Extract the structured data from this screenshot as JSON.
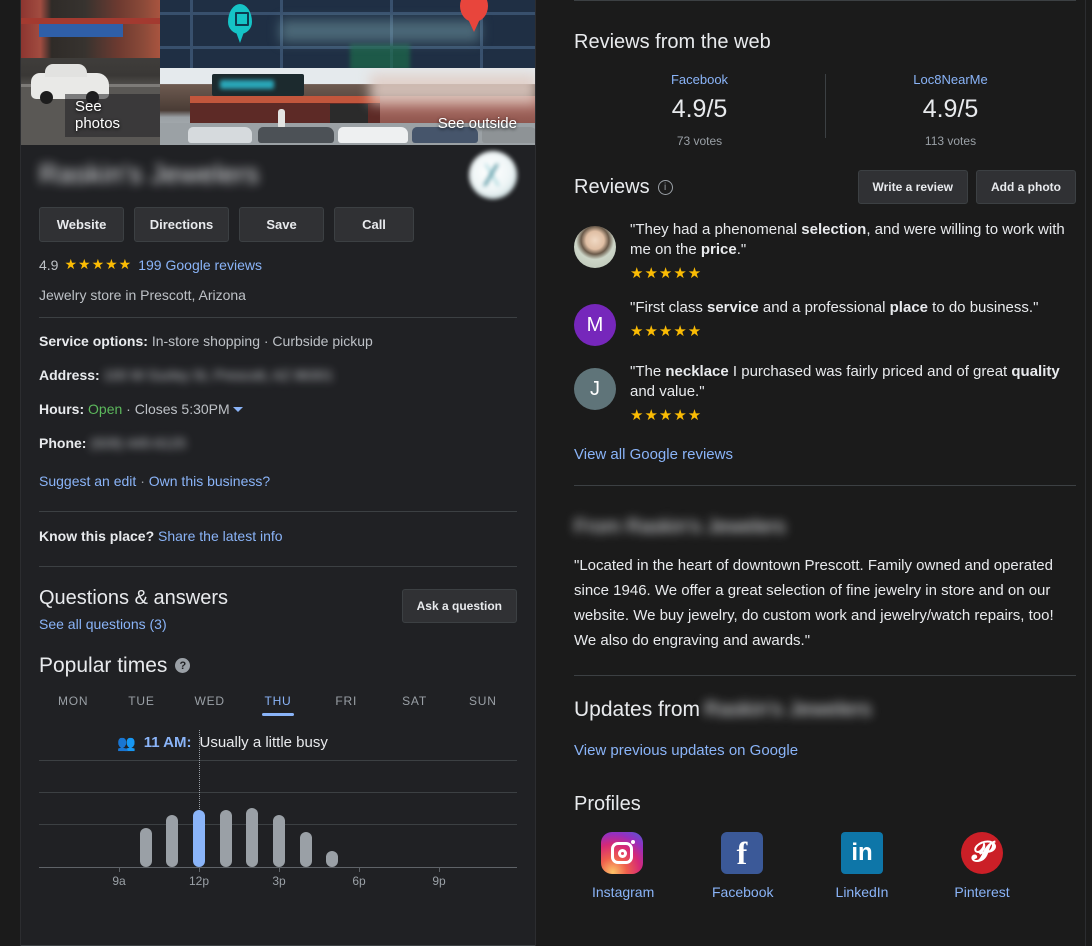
{
  "photos": {
    "see_photos_label": "See photos",
    "see_outside_label": "See outside"
  },
  "business": {
    "name_redacted": "Raskin's Jewelers",
    "rating": "4.9",
    "stars": "★★★★★",
    "reviews_link": "199 Google reviews",
    "category": "Jewelry store in Prescott, Arizona",
    "actions": [
      {
        "label": "Website"
      },
      {
        "label": "Directions"
      },
      {
        "label": "Save"
      },
      {
        "label": "Call"
      }
    ]
  },
  "info": {
    "service_options_label": "Service options:",
    "service_options_value": "In-store shopping · Curbside pickup",
    "address_label": "Address:",
    "address_value": "100 W Gurley St, Prescott, AZ 86301",
    "hours_label": "Hours:",
    "hours_status": "Open",
    "hours_sep": "·",
    "hours_close": "Closes 5:30PM",
    "phone_label": "Phone:",
    "phone_value": "(928) 445-6125",
    "suggest_edit": "Suggest an edit",
    "link_sep": "·",
    "own_business": "Own this business?",
    "know_place_label": "Know this place?",
    "share_info_link": "Share the latest info"
  },
  "qa": {
    "title": "Questions & answers",
    "see_all": "See all questions (3)",
    "ask_button": "Ask a question"
  },
  "popular_times": {
    "title": "Popular times",
    "help_icon_label": "?",
    "days": [
      "MON",
      "TUE",
      "WED",
      "THU",
      "FRI",
      "SAT",
      "SUN"
    ],
    "active_day": "THU",
    "callout_time": "11 AM:",
    "callout_text": "Usually a little busy",
    "people_icon": "people-icon"
  },
  "chart_data": {
    "type": "bar",
    "title": "Popular times",
    "subtitle": "THU",
    "xlabel": "",
    "ylabel": "",
    "grid": true,
    "highlight_index": 2,
    "highlight_color": "#8ab4f8",
    "bar_color": "#9aa0a6",
    "x_tick_labels": [
      "9a",
      "12p",
      "3p",
      "6p",
      "9p"
    ],
    "x_tick_hours": [
      9,
      12,
      15,
      18,
      21
    ],
    "axis_hours": [
      6,
      24
    ],
    "categories": [
      "10a",
      "11a",
      "12p",
      "1p",
      "2p",
      "3p",
      "4p",
      "5p"
    ],
    "hours": [
      10,
      11,
      12,
      13,
      14,
      15,
      16,
      17
    ],
    "values": [
      36,
      48,
      52,
      52,
      54,
      48,
      32,
      14
    ],
    "ylim": [
      0,
      100
    ]
  },
  "web_reviews": {
    "title": "Reviews from the web",
    "sources": [
      {
        "name": "Facebook",
        "score": "4.9/5",
        "votes": "73 votes"
      },
      {
        "name": "Loc8NearMe",
        "score": "4.9/5",
        "votes": "113 votes"
      }
    ]
  },
  "reviews": {
    "title": "Reviews",
    "info_icon": "info-icon",
    "write_review": "Write a review",
    "add_photo": "Add a photo",
    "items": [
      {
        "avatar_type": "photo",
        "avatar_letter": "",
        "text_parts": [
          {
            "t": "\"They had a phenomenal ",
            "b": false
          },
          {
            "t": "selection",
            "b": true
          },
          {
            "t": ", and were willing to work with me on the ",
            "b": false
          },
          {
            "t": "price",
            "b": true
          },
          {
            "t": ".\"",
            "b": false
          }
        ],
        "stars": "★★★★★"
      },
      {
        "avatar_type": "letter",
        "avatar_letter": "M",
        "text_parts": [
          {
            "t": "\"First class ",
            "b": false
          },
          {
            "t": "service",
            "b": true
          },
          {
            "t": " and a professional ",
            "b": false
          },
          {
            "t": "place",
            "b": true
          },
          {
            "t": " to do business.\"",
            "b": false
          }
        ],
        "stars": "★★★★★"
      },
      {
        "avatar_type": "letter",
        "avatar_letter": "J",
        "text_parts": [
          {
            "t": "\"The ",
            "b": false
          },
          {
            "t": "necklace",
            "b": true
          },
          {
            "t": " I purchased was fairly priced and of great ",
            "b": false
          },
          {
            "t": "quality",
            "b": true
          },
          {
            "t": " and value.\"",
            "b": false
          }
        ],
        "stars": "★★★★★"
      }
    ],
    "view_all": "View all Google reviews"
  },
  "from_business": {
    "title_redacted": "From Raskin's Jewelers",
    "description": "\"Located in the heart of downtown Prescott. Family owned and operated since 1946. We offer a great selection of fine jewelry in store and on our website. We buy jewelry, do custom work and jewelry/watch repairs, too! We also do engraving and awards.\""
  },
  "updates": {
    "title_prefix": "Updates from",
    "title_redacted": "Raskin's Jewelers",
    "link": "View previous updates on Google"
  },
  "profiles": {
    "title": "Profiles",
    "items": [
      {
        "label": "Instagram",
        "icon": "instagram-icon"
      },
      {
        "label": "Facebook",
        "icon": "facebook-icon"
      },
      {
        "label": "LinkedIn",
        "icon": "linkedin-icon"
      },
      {
        "label": "Pinterest",
        "icon": "pinterest-icon"
      }
    ]
  },
  "colors": {
    "link": "#8ab4f8",
    "star": "#fbbc04",
    "open_green": "#5cb85c",
    "panel_bg": "#202124",
    "page_bg": "#1b1b1b"
  }
}
